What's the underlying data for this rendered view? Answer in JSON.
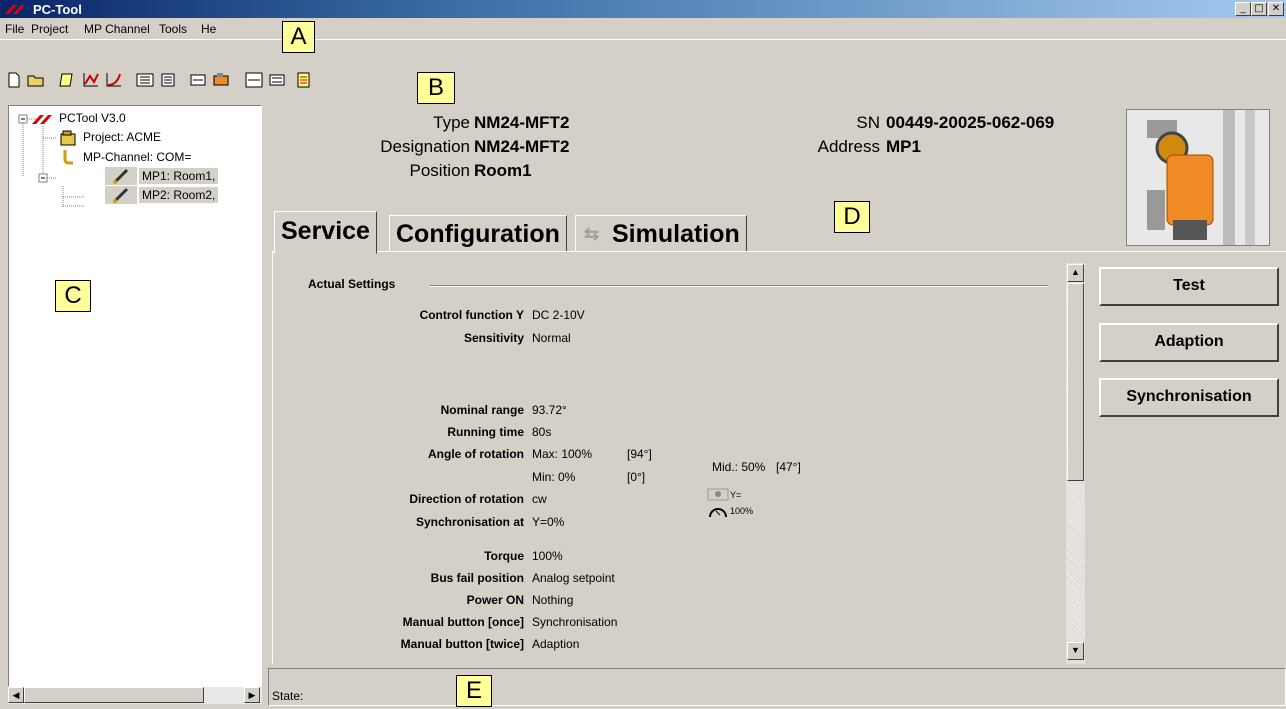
{
  "window": {
    "title": "PC-Tool",
    "minimize": "_",
    "maximize": "□",
    "close": "✕"
  },
  "menu": [
    "File",
    "Project",
    "MP Channel",
    "Tools",
    "He"
  ],
  "callouts": {
    "a": "A",
    "b": "B",
    "c": "C",
    "d": "D",
    "e": "E"
  },
  "tree": {
    "root": "PCTool V3.0",
    "project": "Project: ACME",
    "channel": "MP-Channel: COM=",
    "mp1": "MP1: Room1,",
    "mp2": "MP2: Room2,"
  },
  "header": {
    "type_label": "Type",
    "type_value": "NM24-MFT2",
    "designation_label": "Designation",
    "designation_value": "NM24-MFT2",
    "position_label": "Position",
    "position_value": "Room1",
    "sn_label": "SN",
    "sn_value": "00449-20025-062-069",
    "address_label": "Address",
    "address_value": "MP1"
  },
  "tabs": [
    {
      "label": "Service",
      "active": true
    },
    {
      "label": "Configuration",
      "active": false
    },
    {
      "label": "Simulation",
      "active": false
    }
  ],
  "section_title": "Actual Settings",
  "settings": {
    "control_function": {
      "label": "Control function Y",
      "value": "DC 2-10V"
    },
    "sensitivity": {
      "label": "Sensitivity",
      "value": "Normal"
    },
    "nominal_range": {
      "label": "Nominal range",
      "value": "93.72°"
    },
    "running_time": {
      "label": "Running time",
      "value": "80s"
    },
    "angle": {
      "label": "Angle of rotation",
      "max": "Max: 100%",
      "max_deg": "[94°]",
      "min": "Min: 0%",
      "min_deg": "[0°]",
      "mid": "Mid.: 50%",
      "mid_deg": "[47°]"
    },
    "direction": {
      "label": "Direction of rotation",
      "value": "cw",
      "icon_y": "Y=",
      "icon_pct": "100%"
    },
    "synchronisation_at": {
      "label": "Synchronisation at",
      "value": "Y=0%"
    },
    "torque": {
      "label": "Torque",
      "value": "100%"
    },
    "bus_fail": {
      "label": "Bus fail position",
      "value": "Analog setpoint"
    },
    "power_on": {
      "label": "Power ON",
      "value": "Nothing"
    },
    "manual_once": {
      "label": "Manual button [once]",
      "value": "Synchronisation"
    },
    "manual_twice": {
      "label": "Manual button [twice]",
      "value": "Adaption"
    }
  },
  "buttons": {
    "test": "Test",
    "adaption": "Adaption",
    "synchronisation": "Synchronisation"
  },
  "status": {
    "label": "State:"
  },
  "scroll": {
    "up": "▲",
    "down": "▼",
    "left": "◀",
    "right": "▶"
  },
  "colors": {
    "title_start": "#0a246a",
    "title_end": "#a6caf0",
    "callout": "#ffff99",
    "face": "#d4d0c8",
    "actuator": "#f08a24"
  }
}
